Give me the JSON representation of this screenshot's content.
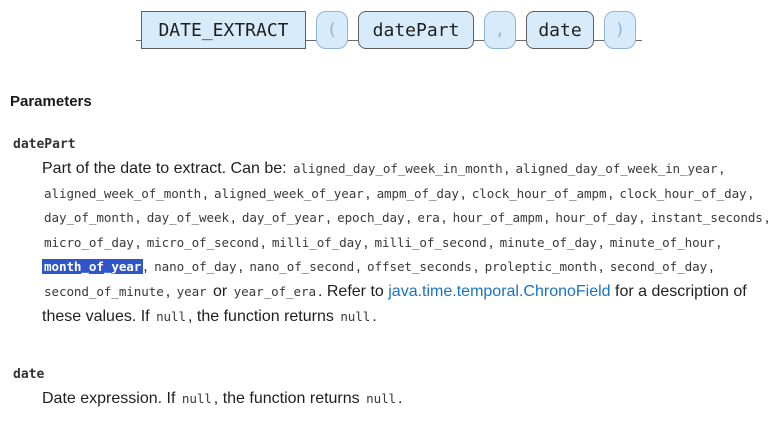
{
  "syntax": {
    "function": "DATE_EXTRACT",
    "open_paren": "(",
    "arg1": "datePart",
    "comma": ",",
    "arg2": "date",
    "close_paren": ")"
  },
  "parameters_heading": "Parameters",
  "params": [
    {
      "name": "datePart",
      "intro": "Part of the date to extract. Can be:",
      "values": [
        "aligned_day_of_week_in_month",
        "aligned_day_of_week_in_year",
        "aligned_week_of_month",
        "aligned_week_of_year",
        "ampm_of_day",
        "clock_hour_of_ampm",
        "clock_hour_of_day",
        "day_of_month",
        "day_of_week",
        "day_of_year",
        "epoch_day",
        "era",
        "hour_of_ampm",
        "hour_of_day",
        "instant_seconds",
        "micro_of_day",
        "micro_of_second",
        "milli_of_day",
        "milli_of_second",
        "minute_of_day",
        "minute_of_hour",
        "month_of_year",
        "nano_of_day",
        "nano_of_second",
        "offset_seconds",
        "proleptic_month",
        "second_of_day",
        "second_of_minute",
        "year",
        "year_of_era"
      ],
      "selected_value": "month_of_year",
      "or_text": "or",
      "refer_text": ". Refer to",
      "link_text": "java.time.temporal.ChronoField",
      "after_link": "for a description of these values. If",
      "null_code": "null",
      "returns_text": ", the function returns",
      "end_text": "."
    },
    {
      "name": "date",
      "desc_prefix": "Date expression. If",
      "null_code": "null",
      "returns_text": ", the function returns",
      "end_text": "."
    }
  ]
}
